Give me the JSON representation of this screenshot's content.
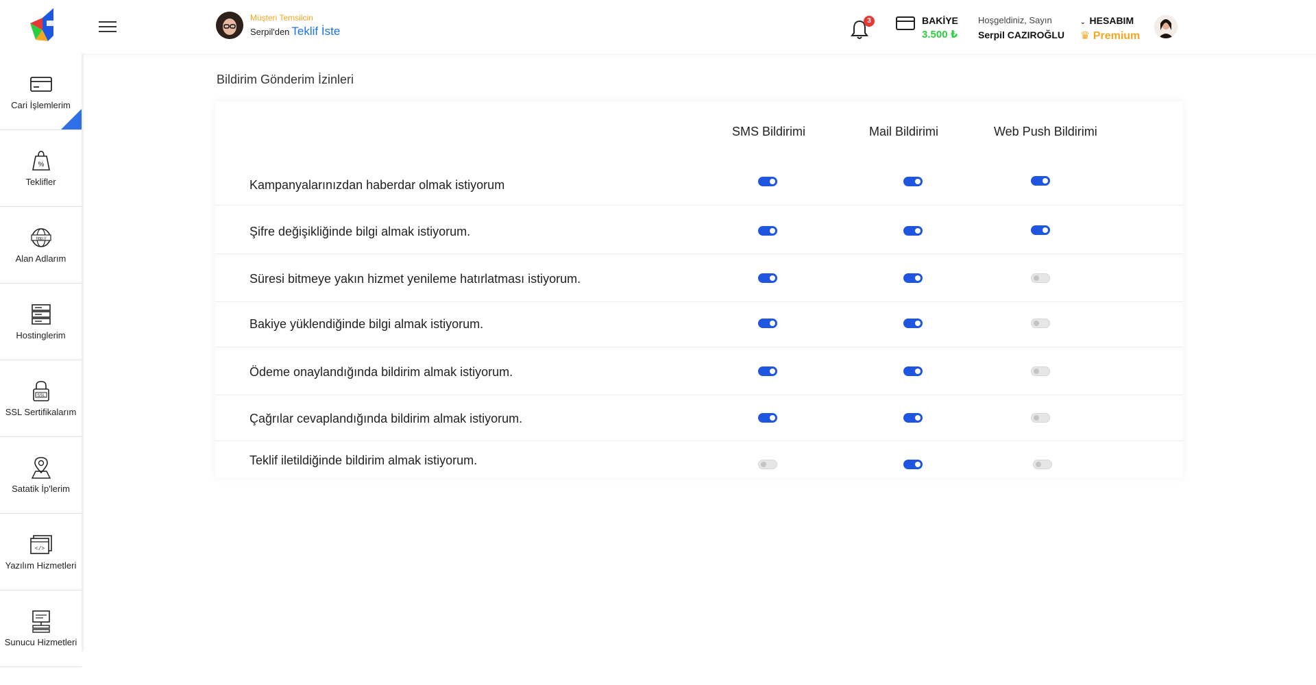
{
  "header": {
    "rep_title": "Müşteri Temsilcin",
    "rep_from": "Serpil'den",
    "rep_link": "Teklif İste",
    "notification_count": "3",
    "balance_label": "BAKİYE",
    "balance_value": "3.500 ₺",
    "welcome": "Hoşgeldiniz, Sayın",
    "user_name": "Serpil CAZIROĞLU",
    "account_label": "HESABIM",
    "premium_label": "Premium"
  },
  "sidebar": {
    "items": [
      {
        "label": "Cari İşlemlerim",
        "icon": "card-icon",
        "active": true
      },
      {
        "label": "Teklifler",
        "icon": "discount-tag-icon",
        "active": false
      },
      {
        "label": "Alan Adlarım",
        "icon": "globe-http-icon",
        "active": false
      },
      {
        "label": "Hostinglerim",
        "icon": "server-icon",
        "active": false
      },
      {
        "label": "SSL Sertifikalarım",
        "icon": "ssl-lock-icon",
        "active": false
      },
      {
        "label": "Satatik İp'lerim",
        "icon": "map-pin-icon",
        "active": false
      },
      {
        "label": "Yazılım Hizmetleri",
        "icon": "code-window-icon",
        "active": false
      },
      {
        "label": "Sunucu Hizmetleri",
        "icon": "monitor-server-icon",
        "active": false
      }
    ]
  },
  "main": {
    "title": "Bildirim Gönderim İzinleri",
    "columns": [
      "SMS Bildirimi",
      "Mail Bildirimi",
      "Web Push Bildirimi"
    ],
    "rows": [
      {
        "label": "Kampanyalarınızdan haberdar olmak istiyorum",
        "sms": true,
        "mail": true,
        "push": true
      },
      {
        "label": "Şifre değişikliğinde bilgi almak istiyorum.",
        "sms": true,
        "mail": true,
        "push": true
      },
      {
        "label": "Süresi bitmeye yakın hizmet yenileme hatırlatması istiyorum.",
        "sms": true,
        "mail": true,
        "push": false
      },
      {
        "label": "Bakiye yüklendiğinde bilgi almak istiyorum.",
        "sms": true,
        "mail": true,
        "push": false
      },
      {
        "label": "Ödeme onaylandığında bildirim almak istiyorum.",
        "sms": true,
        "mail": true,
        "push": false
      },
      {
        "label": "Çağrılar cevaplandığında bildirim almak istiyorum.",
        "sms": true,
        "mail": true,
        "push": false
      },
      {
        "label": "Teklif iletildiğinde  bildirim almak istiyorum.",
        "sms": false,
        "mail": true,
        "push": false
      }
    ]
  },
  "colors": {
    "accent": "#1f56e0",
    "premium": "#f5a623",
    "balance": "#2ecc40",
    "badge": "#e53935"
  }
}
